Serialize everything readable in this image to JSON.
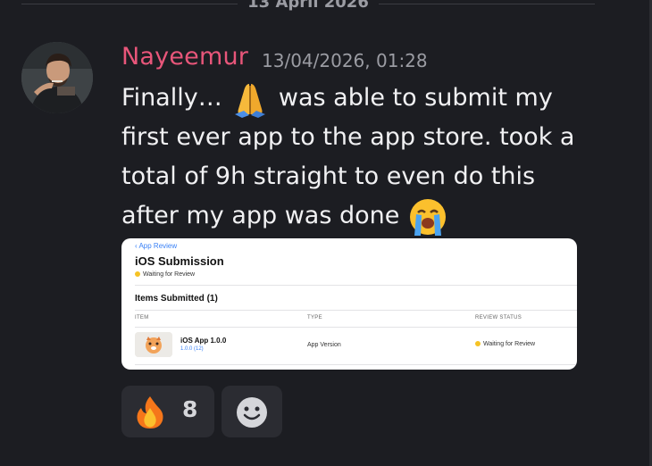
{
  "date_separator": "13 April 2026",
  "message": {
    "author": "Nayeemur",
    "author_color": "#e8567a",
    "timestamp": "13/04/2026, 01:28",
    "text_part1": "Finally… ",
    "emoji_1": "folded-hands-icon",
    "text_part2": " was able to submit my first ever app to the app store. took a total of 9h straight to even do this after my app was done ",
    "emoji_2": "loudly-crying-face-icon"
  },
  "attachment": {
    "back_link": "App Review",
    "title": "iOS Submission",
    "status": "Waiting for Review",
    "section_title": "Items Submitted (1)",
    "columns": [
      "ITEM",
      "TYPE",
      "REVIEW STATUS"
    ],
    "rows": [
      {
        "name": "iOS App 1.0.0",
        "version": "1.0.0 (12)",
        "type": "App Version",
        "review_status": "Waiting for Review"
      }
    ],
    "status_color": "#f6c325"
  },
  "reactions": [
    {
      "icon": "fire-icon",
      "count": "8"
    },
    {
      "icon": "add-reaction-icon"
    }
  ]
}
